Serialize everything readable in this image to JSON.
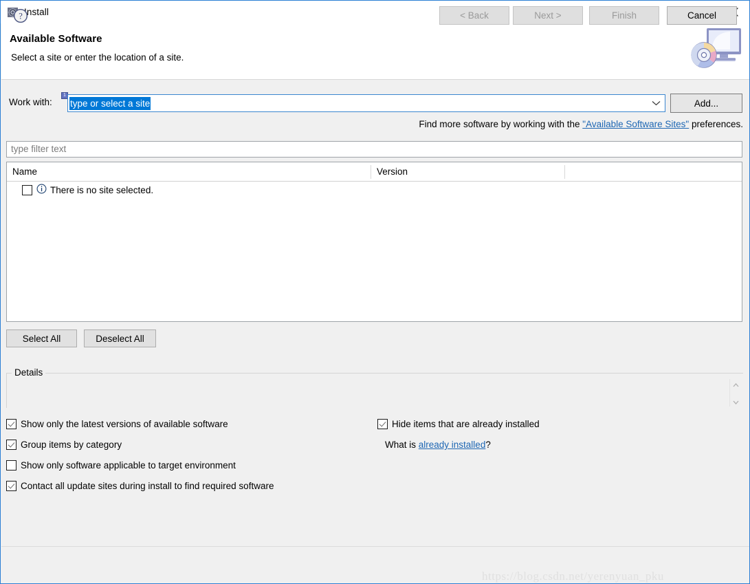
{
  "window": {
    "title": "Install",
    "icon": "install-gear-icon",
    "controls": {
      "minimize": "minimize-icon",
      "maximize": "maximize-icon",
      "close": "close-icon"
    }
  },
  "header": {
    "title": "Available Software",
    "subtitle": "Select a site or enter the location of a site.",
    "banner_icon": "computer-cd-icon"
  },
  "work_with": {
    "label": "Work with:",
    "value": "type or select a site",
    "placeholder": "type or select a site",
    "hint_badge": "1",
    "add_button": "Add...",
    "dropdown_icon": "chevron-down-icon"
  },
  "find_more": {
    "prefix": "Find more software by working with the ",
    "link": "\"Available Software Sites\"",
    "suffix": " preferences."
  },
  "filter": {
    "placeholder": "type filter text",
    "value": ""
  },
  "table": {
    "columns": [
      "Name",
      "Version"
    ],
    "rows": [
      {
        "checked": false,
        "icon": "info-icon",
        "name": "There is no site selected.",
        "version": ""
      }
    ]
  },
  "selection_buttons": {
    "select_all": "Select All",
    "deselect_all": "Deselect All"
  },
  "details": {
    "title": "Details",
    "content": "",
    "scroll_up_icon": "chevron-up-icon",
    "scroll_down_icon": "chevron-down-icon"
  },
  "options": {
    "left": [
      {
        "label": "Show only the latest versions of available software",
        "checked": true
      },
      {
        "label": "Group items by category",
        "checked": true
      },
      {
        "label": "Show only software applicable to target environment",
        "checked": false
      },
      {
        "label": "Contact all update sites during install to find required software",
        "checked": true
      }
    ],
    "right": [
      {
        "label": "Hide items that are already installed",
        "checked": true
      }
    ],
    "what_is": {
      "prefix": "What is ",
      "link": "already installed",
      "suffix": "?"
    }
  },
  "footer": {
    "help_icon": "help-question-icon",
    "buttons": [
      {
        "label": "< Back",
        "enabled": false
      },
      {
        "label": "Next >",
        "enabled": false
      },
      {
        "label": "Finish",
        "enabled": false
      },
      {
        "label": "Cancel",
        "enabled": true
      }
    ]
  },
  "watermark": "https://blog.csdn.net/yerenyuan_pku",
  "colors": {
    "dialog_border": "#2a7fd4",
    "selection_blue": "#0078d7",
    "link_blue": "#1d66b3",
    "body_bg": "#f0f0f0"
  }
}
